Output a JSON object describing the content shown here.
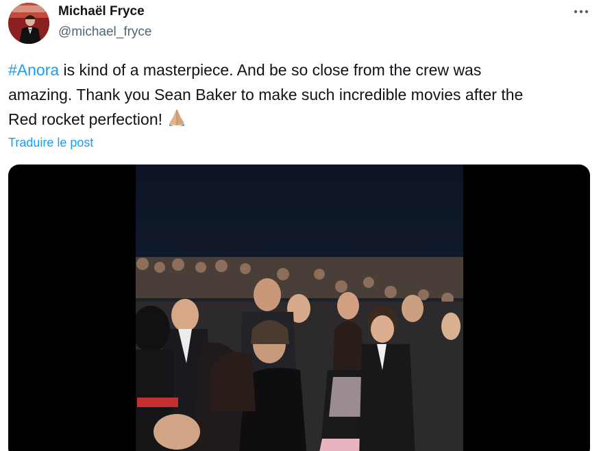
{
  "author": {
    "name": "Michaël Fryce",
    "handle": "@michael_fryce"
  },
  "tweet": {
    "hashtag": "#Anora",
    "line1_rest": " is kind of a masterpiece. And be so close from the crew was",
    "line2": "amazing. Thank you Sean Baker to make such incredible movies after the",
    "line3": "Red rocket perfection!",
    "emoji": "folded-hands-emoji",
    "translate_label": "Traduire le post"
  },
  "icons": {
    "more": "more-options-icon"
  },
  "colors": {
    "link": "#1d9bf0",
    "text": "#0f1419",
    "secondary": "#536471",
    "media_bg": "#000000"
  }
}
